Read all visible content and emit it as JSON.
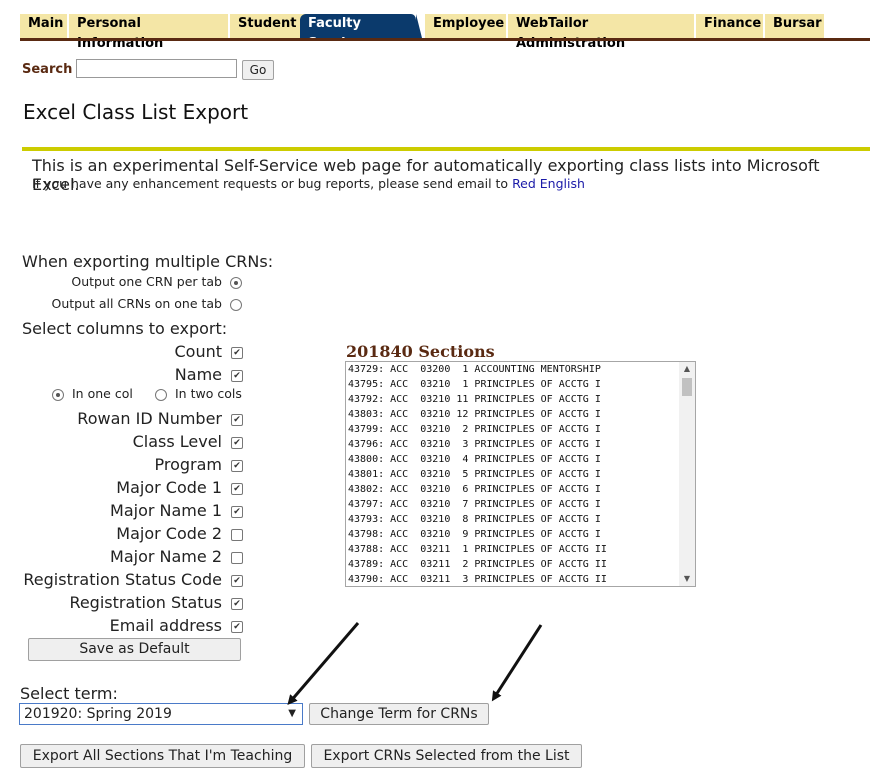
{
  "nav": {
    "tabs": [
      {
        "label": "Main",
        "active": false
      },
      {
        "label": "Personal Information",
        "active": false
      },
      {
        "label": "Student",
        "active": false
      },
      {
        "label": "Faculty Services",
        "active": true
      },
      {
        "label": "Employee",
        "active": false
      },
      {
        "label": "WebTailor Administration",
        "active": false
      },
      {
        "label": "Finance",
        "active": false
      },
      {
        "label": "Bursar",
        "active": false
      }
    ]
  },
  "search": {
    "label": "Search",
    "value": "",
    "button": "Go"
  },
  "page_title": "Excel Class List Export",
  "info": {
    "main": "This is an experimental Self-Service web page for automatically exporting class lists into Microsoft Excel.",
    "sub": "If you have any enhancement requests or bug reports, please send email to",
    "contact": "Red English"
  },
  "multi_export": {
    "heading": "When exporting multiple CRNs:",
    "options": [
      {
        "label": "Output one CRN per tab",
        "selected": true
      },
      {
        "label": "Output all CRNs on one tab",
        "selected": false
      }
    ]
  },
  "columns": {
    "heading": "Select columns to export:",
    "items": [
      {
        "label": "Count",
        "checked": true
      },
      {
        "label": "Name",
        "checked": true
      },
      {
        "label": "Rowan ID Number",
        "checked": true
      },
      {
        "label": "Class Level",
        "checked": true
      },
      {
        "label": "Program",
        "checked": true
      },
      {
        "label": "Major Code 1",
        "checked": true
      },
      {
        "label": "Major Name 1",
        "checked": true
      },
      {
        "label": "Major Code 2",
        "checked": false
      },
      {
        "label": "Major Name 2",
        "checked": false
      },
      {
        "label": "Registration Status Code",
        "checked": true
      },
      {
        "label": "Registration Status",
        "checked": true
      },
      {
        "label": "Email address",
        "checked": true
      }
    ],
    "name_format": [
      {
        "label": "In one col",
        "selected": true
      },
      {
        "label": "In two cols",
        "selected": false
      }
    ],
    "save_button": "Save as Default"
  },
  "sections": {
    "title": "201840 Sections",
    "items": [
      "43729: ACC  03200  1 ACCOUNTING MENTORSHIP",
      "43795: ACC  03210  1 PRINCIPLES OF ACCTG I",
      "43792: ACC  03210 11 PRINCIPLES OF ACCTG I",
      "43803: ACC  03210 12 PRINCIPLES OF ACCTG I",
      "43799: ACC  03210  2 PRINCIPLES OF ACCTG I",
      "43796: ACC  03210  3 PRINCIPLES OF ACCTG I",
      "43800: ACC  03210  4 PRINCIPLES OF ACCTG I",
      "43801: ACC  03210  5 PRINCIPLES OF ACCTG I",
      "43802: ACC  03210  6 PRINCIPLES OF ACCTG I",
      "43797: ACC  03210  7 PRINCIPLES OF ACCTG I",
      "43793: ACC  03210  8 PRINCIPLES OF ACCTG I",
      "43798: ACC  03210  9 PRINCIPLES OF ACCTG I",
      "43788: ACC  03211  1 PRINCIPLES OF ACCTG II",
      "43789: ACC  03211  2 PRINCIPLES OF ACCTG II",
      "43790: ACC  03211  3 PRINCIPLES OF ACCTG II"
    ]
  },
  "term": {
    "label": "Select term:",
    "selected": "201920: Spring 2019",
    "change_button": "Change Term for CRNs"
  },
  "export": {
    "all_button": "Export All Sections That I'm Teaching",
    "selected_button": "Export CRNs Selected from the List"
  },
  "colors": {
    "tab_bg": "#f4e6a6",
    "tab_active": "#0b3a6c",
    "accent_rule": "#cccc00",
    "heading_brown": "#5a2a12",
    "link": "#1a1aa8"
  }
}
